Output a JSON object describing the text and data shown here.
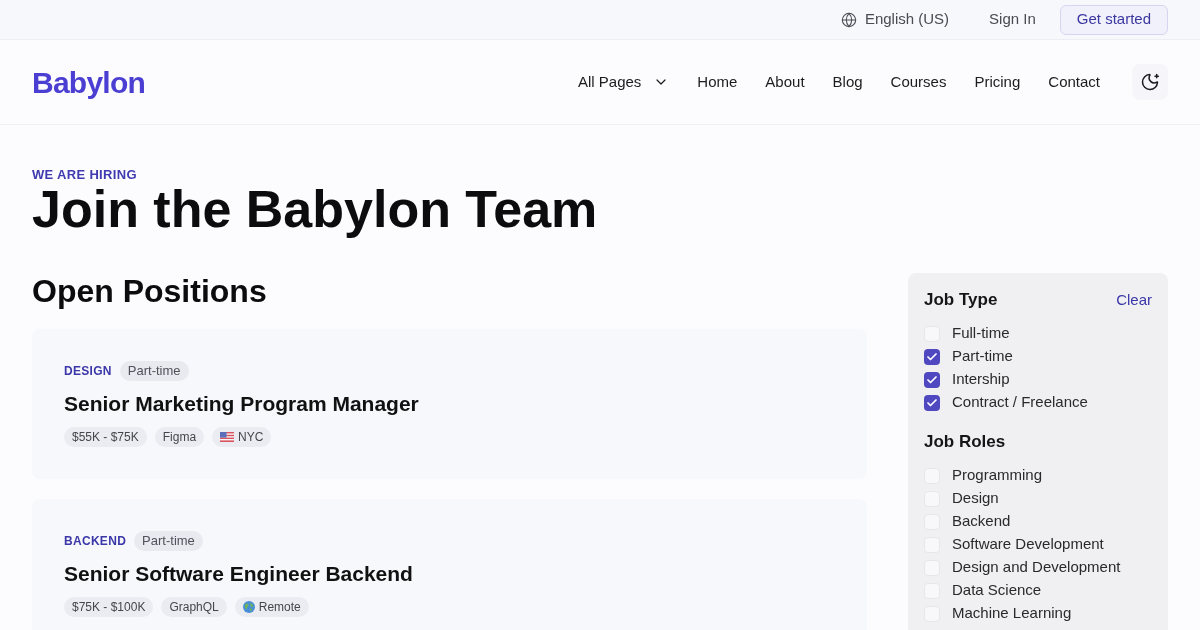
{
  "top_bar": {
    "language": "English (US)",
    "sign_in": "Sign In",
    "cta": "Get started"
  },
  "nav": {
    "logo": "Babylon",
    "items": [
      {
        "label": "All Pages",
        "kind": "dropdown"
      },
      {
        "label": "Home",
        "kind": "link"
      },
      {
        "label": "About",
        "kind": "link"
      },
      {
        "label": "Blog",
        "kind": "link"
      },
      {
        "label": "Courses",
        "kind": "link"
      },
      {
        "label": "Pricing",
        "kind": "link"
      },
      {
        "label": "Contact",
        "kind": "link"
      }
    ]
  },
  "hero": {
    "eyebrow": "WE ARE HIRING",
    "title": "Join the Babylon Team"
  },
  "positions": {
    "heading": "Open Positions",
    "jobs": [
      {
        "category": "DESIGN",
        "type": "Part-time",
        "title": "Senior Marketing Program Manager",
        "tags": [
          {
            "kind": "salary",
            "label": "$55K - $75K"
          },
          {
            "kind": "skill",
            "label": "Figma"
          },
          {
            "kind": "city",
            "label": "NYC"
          }
        ]
      },
      {
        "category": "BACKEND",
        "type": "Part-time",
        "title": "Senior Software Engineer Backend",
        "tags": [
          {
            "kind": "salary",
            "label": "$75K - $100K"
          },
          {
            "kind": "skill",
            "label": "GraphQL"
          },
          {
            "kind": "remote",
            "label": "Remote"
          }
        ]
      }
    ]
  },
  "filters": {
    "groups": [
      {
        "title": "Job Type",
        "action": "Clear",
        "options": [
          {
            "label": "Full-time",
            "checked": false
          },
          {
            "label": "Part-time",
            "checked": true
          },
          {
            "label": "Intership",
            "checked": true
          },
          {
            "label": "Contract / Freelance",
            "checked": true
          }
        ]
      },
      {
        "title": "Job Roles",
        "options": [
          {
            "label": "Programming",
            "checked": false
          },
          {
            "label": "Design",
            "checked": false
          },
          {
            "label": "Backend",
            "checked": false
          },
          {
            "label": "Software Development",
            "checked": false
          },
          {
            "label": "Design and Development",
            "checked": false
          },
          {
            "label": "Data Science",
            "checked": false
          },
          {
            "label": "Machine Learning",
            "checked": false
          }
        ]
      }
    ]
  }
}
